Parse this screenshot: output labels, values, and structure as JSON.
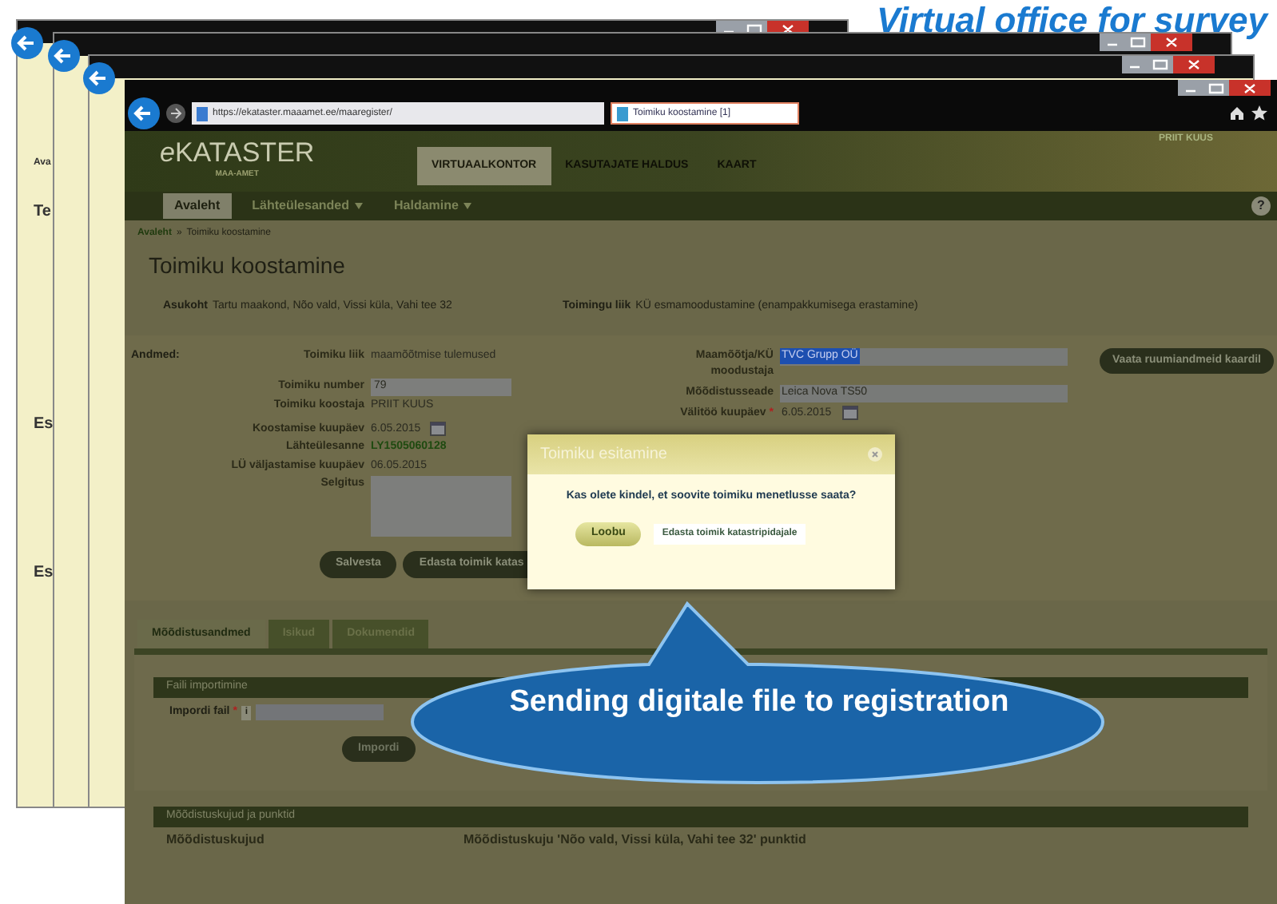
{
  "slide_title": "Virtual office for survey",
  "back_window_fragments": [
    "Ava",
    "Te",
    "Es",
    "Es"
  ],
  "browser": {
    "url": "https://ekataster.maaamet.ee/maaregister/",
    "tab": "Toimiku koostamine [1]"
  },
  "header": {
    "logo_prefix": "e",
    "logo": "KATASTER",
    "logo_sub": "MAA-AMET",
    "user": "PRIIT KUUS",
    "nav": [
      {
        "label": "VIRTUAALKONTOR",
        "selected": true
      },
      {
        "label": "KASUTAJATE HALDUS",
        "selected": false
      },
      {
        "label": "KAART",
        "selected": false
      }
    ]
  },
  "menu": [
    {
      "label": "Avaleht",
      "selected": true,
      "dropdown": false
    },
    {
      "label": "Lähteülesanded",
      "selected": false,
      "dropdown": true
    },
    {
      "label": "Haldamine",
      "selected": false,
      "dropdown": true
    }
  ],
  "help": "?",
  "breadcrumb": {
    "link": "Avaleht",
    "separator": "»",
    "current": "Toimiku koostamine"
  },
  "page_title": "Toimiku koostamine",
  "summary": [
    {
      "label": "Asukoht",
      "value": "Tartu maakond, Nõo vald, Vissi küla, Vahi tee 32"
    },
    {
      "label": "Toimingu liik",
      "value": "KÜ esmamoodustamine (enampakkumisega erastamine)"
    }
  ],
  "form": {
    "section_label": "Andmed:",
    "left": [
      {
        "kind": "text",
        "label": "Toimiku liik",
        "value": "maamõõtmise tulemused"
      },
      {
        "kind": "field",
        "label": "Toimiku number",
        "value": "79"
      },
      {
        "kind": "text",
        "label": "Toimiku koostaja",
        "value": "PRIIT KUUS"
      },
      {
        "kind": "date",
        "label": "Koostamise kuupäev",
        "value": "6.05.2015"
      },
      {
        "kind": "link",
        "label": "Lähteülesanne",
        "value": "LY1505060128"
      },
      {
        "kind": "text",
        "label": "LÜ väljastamise kuupäev",
        "value": "06.05.2015"
      },
      {
        "kind": "textarea",
        "label": "Selgitus"
      }
    ],
    "right": [
      {
        "kind": "field",
        "label": "Maamõõtja/KÜ moodustaja",
        "value": "TVC Grupp OÜ",
        "highlighted": true,
        "required": false
      },
      {
        "kind": "field",
        "label": "Mõõdistusseade",
        "value": "Leica Nova TS50",
        "highlighted": false,
        "required": false
      },
      {
        "kind": "date",
        "label": "Välitöö kuupäev",
        "value": "6.05.2015",
        "highlighted": false,
        "required": true
      }
    ],
    "required_mark": "*",
    "map_button": "Vaata ruumiandmeid kaardil",
    "buttons": [
      "Salvesta",
      "Edasta toimik katas"
    ]
  },
  "dialog": {
    "title": "Toimiku esitamine",
    "message": "Kas olete kindel, et soovite toimiku menetlusse saata?",
    "cancel": "Loobu",
    "confirm": "Edasta toimik katastripidajale"
  },
  "tabs": [
    {
      "label": "Mõõdistusandmed",
      "selected": true
    },
    {
      "label": "Isikud",
      "selected": false
    },
    {
      "label": "Dokumendid",
      "selected": false
    }
  ],
  "import_panel": {
    "title": "Faili importimine",
    "label": "Impordi fail",
    "required": true,
    "required_mark": "*",
    "info": "i",
    "button": "Impordi"
  },
  "shapes_panel": {
    "title": "Mõõdistuskujud ja punktid",
    "column_1": "Mõõdistuskujud",
    "column_2": "Mõõdistuskuju 'Nõo vald, Vissi küla, Vahi tee 32' punktid"
  },
  "callout": "Sending digitale file to registration"
}
